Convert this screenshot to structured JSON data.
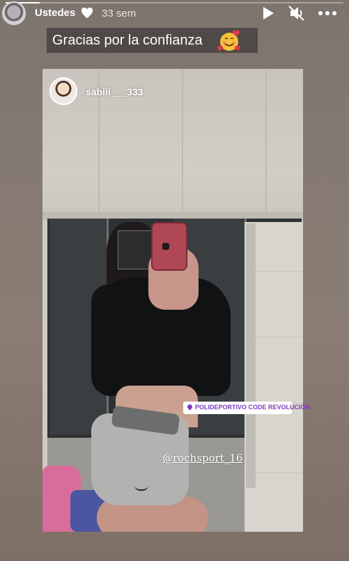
{
  "story": {
    "progress": 0.1,
    "username": "Ustedes",
    "time_ago": "33 sem",
    "caption": "Gracias por la confianza",
    "caption_emoji": "smiling-face-with-hearts"
  },
  "controls": {
    "play_icon": "play-icon",
    "mute_icon": "muted-speaker-icon",
    "more_icon": "more-options-icon"
  },
  "reshared_post": {
    "username": "sabiii___333",
    "location_sticker": "POLIDEPORTIVO CODE REVOLUCIÓN",
    "mention": "@rochsport_16"
  },
  "colors": {
    "background": "#857a73",
    "location_purple": "#7c3bbd"
  }
}
